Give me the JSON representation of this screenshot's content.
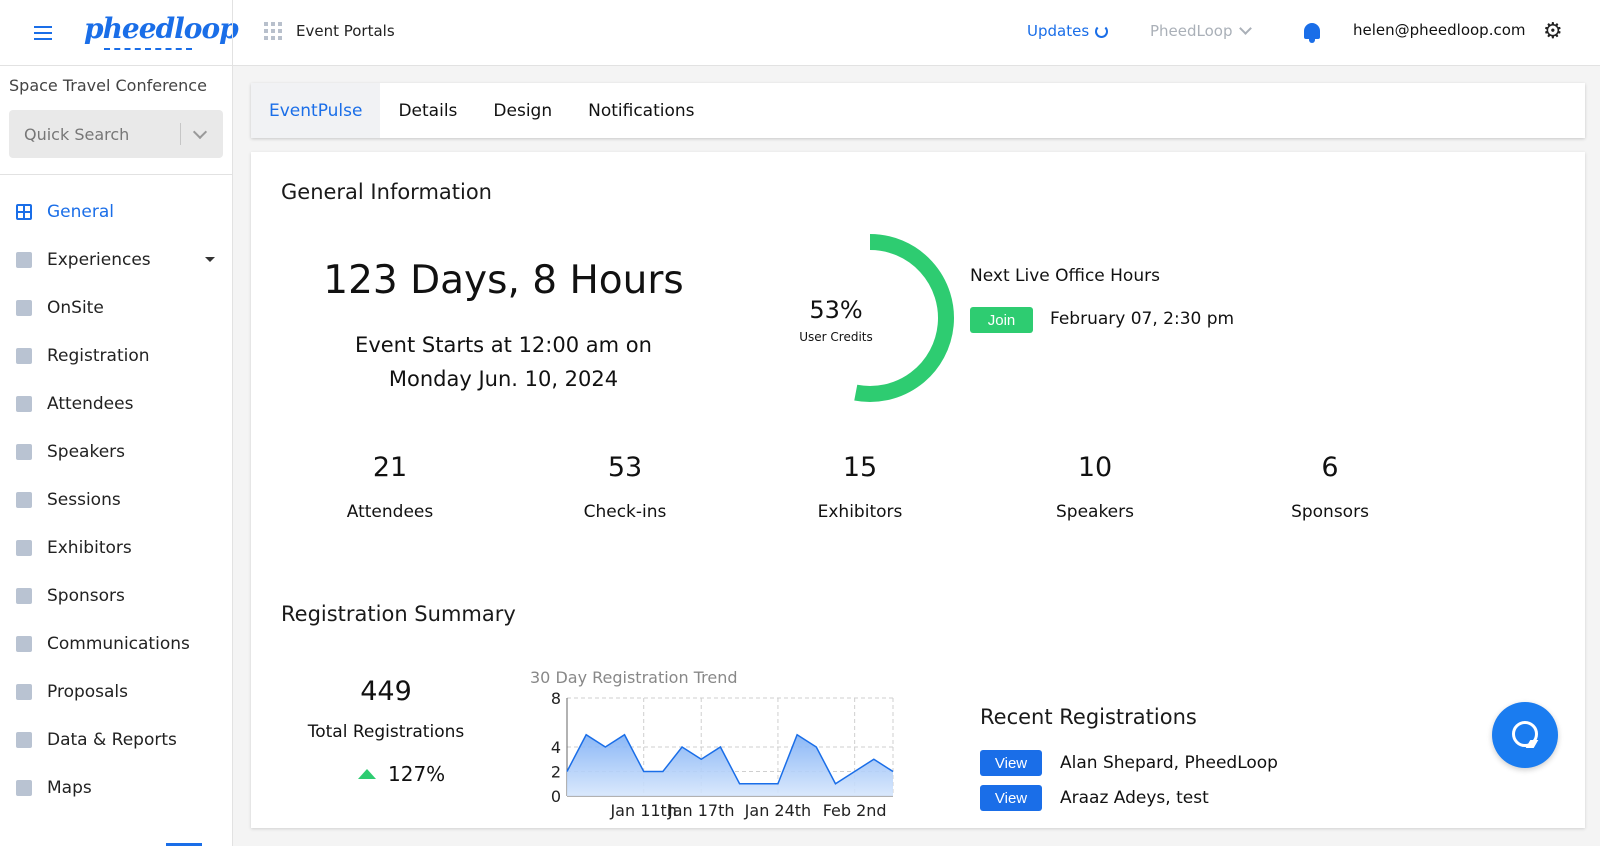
{
  "header": {
    "logo": "pheedloop",
    "portals_label": "Event Portals",
    "updates_label": "Updates",
    "org_label": "PheedLoop",
    "user_email": "helen@pheedloop.com"
  },
  "sidebar": {
    "event_name": "Space Travel Conference",
    "search_placeholder": "Quick Search",
    "items": [
      {
        "label": "General",
        "icon": "grid-icon",
        "active": true
      },
      {
        "label": "Experiences",
        "icon": "person-icon"
      },
      {
        "label": "OnSite",
        "icon": "printer-icon"
      },
      {
        "label": "Registration",
        "icon": "cart-icon"
      },
      {
        "label": "Attendees",
        "icon": "people-icon"
      },
      {
        "label": "Speakers",
        "icon": "presenter-icon"
      },
      {
        "label": "Sessions",
        "icon": "laptop-icon"
      },
      {
        "label": "Exhibitors",
        "icon": "store-icon"
      },
      {
        "label": "Sponsors",
        "icon": "badge-icon"
      },
      {
        "label": "Communications",
        "icon": "mail-icon"
      },
      {
        "label": "Proposals",
        "icon": "document-icon"
      },
      {
        "label": "Data & Reports",
        "icon": "chart-icon"
      },
      {
        "label": "Maps",
        "icon": "map-icon"
      }
    ]
  },
  "tabs": [
    {
      "label": "EventPulse",
      "active": true
    },
    {
      "label": "Details"
    },
    {
      "label": "Design"
    },
    {
      "label": "Notifications"
    }
  ],
  "general": {
    "title": "General Information",
    "countdown": "123 Days, 8 Hours",
    "starts_line1": "Event Starts at 12:00 am on",
    "starts_line2": "Monday Jun. 10, 2024",
    "credits_percent": "53%",
    "credits_fraction": 0.53,
    "credits_label": "User Credits",
    "office_hours_title": "Next Live Office Hours",
    "join_label": "Join",
    "office_hours_date": "February 07, 2:30 pm",
    "stats": [
      {
        "value": "21",
        "label": "Attendees"
      },
      {
        "value": "53",
        "label": "Check-ins"
      },
      {
        "value": "15",
        "label": "Exhibitors"
      },
      {
        "value": "10",
        "label": "Speakers"
      },
      {
        "value": "6",
        "label": "Sponsors"
      }
    ]
  },
  "registration": {
    "title": "Registration Summary",
    "total": "449",
    "total_label": "Total Registrations",
    "growth": "127%",
    "recent_title": "Recent Registrations",
    "view_label": "View",
    "recent": [
      {
        "name": "Alan Shepard, PheedLoop"
      },
      {
        "name": "Araaz Adeys, test"
      }
    ]
  },
  "chart_data": {
    "type": "area",
    "title": "30 Day Registration Trend",
    "ylim": [
      0,
      8
    ],
    "yticks": [
      0,
      2,
      4,
      8
    ],
    "xticks": [
      "Jan 11th",
      "Jan 17th",
      "Jan 24th",
      "Feb 2nd"
    ],
    "values": [
      2,
      5,
      4,
      5,
      2,
      2,
      4,
      3,
      4,
      1,
      1,
      1,
      5,
      4,
      1,
      2,
      3,
      2
    ],
    "grid": true
  },
  "colors": {
    "accent": "#1a6ee8",
    "success": "#2ecc71",
    "chart_fill": "#9ec3f7",
    "chart_line": "#1a6ee8"
  }
}
